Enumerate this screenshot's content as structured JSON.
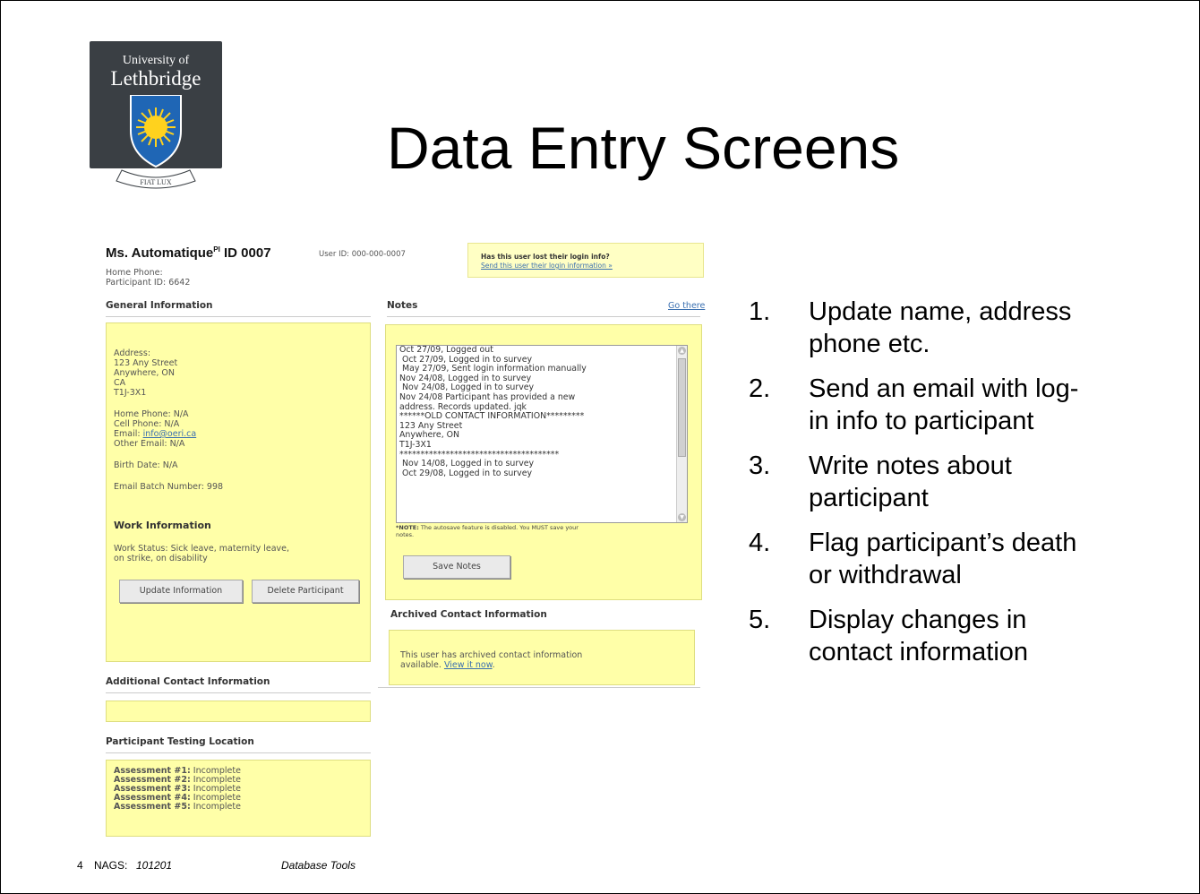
{
  "logo": {
    "line1": "University of",
    "line2": "Lethbridge",
    "motto": "FIAT LUX",
    "colors": {
      "background": "#3a3f44",
      "shield": "#1f66b5",
      "sun": "#ffd21e"
    }
  },
  "slide_title": "Data Entry Screens",
  "screen": {
    "name": "Ms. Automatique",
    "name_sup": "PI",
    "id_label": "ID 0007",
    "user_id": "User ID: 000-000-0007",
    "home_phone": "Home Phone:",
    "participant_id": "Participant ID: 6642",
    "lost_login": {
      "question": "Has this user lost their login info?",
      "link": "Send this user their login information »"
    },
    "general": {
      "heading": "General Information",
      "address_lines": [
        "Address:",
        "123 Any Street",
        "Anywhere, ON",
        "CA",
        "T1J-3X1"
      ],
      "home_phone": "Home Phone: N/A",
      "cell_phone": "Cell Phone: N/A",
      "email_label": "Email:",
      "email_value": "info@oeri.ca",
      "other_email": "Other Email: N/A",
      "birth_date": "Birth Date: N/A",
      "batch": "Email Batch Number: 998",
      "work_heading": "Work Information",
      "work_status_1": "Work Status: Sick leave, maternity leave,",
      "work_status_2": "on strike, on disability",
      "update_button": "Update Information",
      "delete_button": "Delete Participant"
    },
    "notes": {
      "heading": "Notes",
      "go_there": "Go there",
      "lines": [
        "Oct 27/09, Logged out",
        " Oct 27/09, Logged in to survey",
        " May 27/09, Sent login information manually",
        "Nov 24/08, Logged in to survey",
        " Nov 24/08, Logged in to survey",
        "Nov 24/08 Participant has provided a new",
        "address. Records updated. jqk",
        "******OLD CONTACT INFORMATION*********",
        "123 Any Street",
        "Anywhere, ON",
        "T1J-3X1",
        "**************************************",
        "",
        " Nov 14/08, Logged in to survey",
        " Oct 29/08, Logged in to survey"
      ],
      "note_bold": "*NOTE:",
      "note_text_1": " The autosave feature is disabled. You MUST save your",
      "note_text_2": "notes.",
      "save_button": "Save Notes"
    },
    "archived": {
      "heading": "Archived Contact Information",
      "text_1": "This user has archived contact information",
      "text_2": "available.",
      "link": "View it now",
      "text_end": "."
    },
    "additional": {
      "heading": "Additional Contact Information"
    },
    "testing": {
      "heading": "Participant Testing Location",
      "assessments": [
        {
          "label": "Assessment #1:",
          "value": " Incomplete"
        },
        {
          "label": "Assessment #2:",
          "value": " Incomplete"
        },
        {
          "label": "Assessment #3:",
          "value": " Incomplete"
        },
        {
          "label": "Assessment #4:",
          "value": " Incomplete"
        },
        {
          "label": "Assessment #5:",
          "value": " Incomplete"
        }
      ]
    }
  },
  "features": [
    {
      "num": "1.",
      "lines": [
        "Update name, address",
        "phone etc."
      ]
    },
    {
      "num": "2.",
      "lines": [
        "Send an email with log-",
        "in info to participant"
      ]
    },
    {
      "num": "3.",
      "lines": [
        "Write notes about",
        "participant"
      ]
    },
    {
      "num": "4.",
      "lines": [
        "Flag participant’s death",
        "or withdrawal"
      ]
    },
    {
      "num": "5.",
      "lines": [
        "Display changes in",
        "contact information"
      ]
    }
  ],
  "footer": {
    "slide_number": "4",
    "nags_label": "NAGS:",
    "nags_code": "101201",
    "topic": "Database Tools"
  }
}
